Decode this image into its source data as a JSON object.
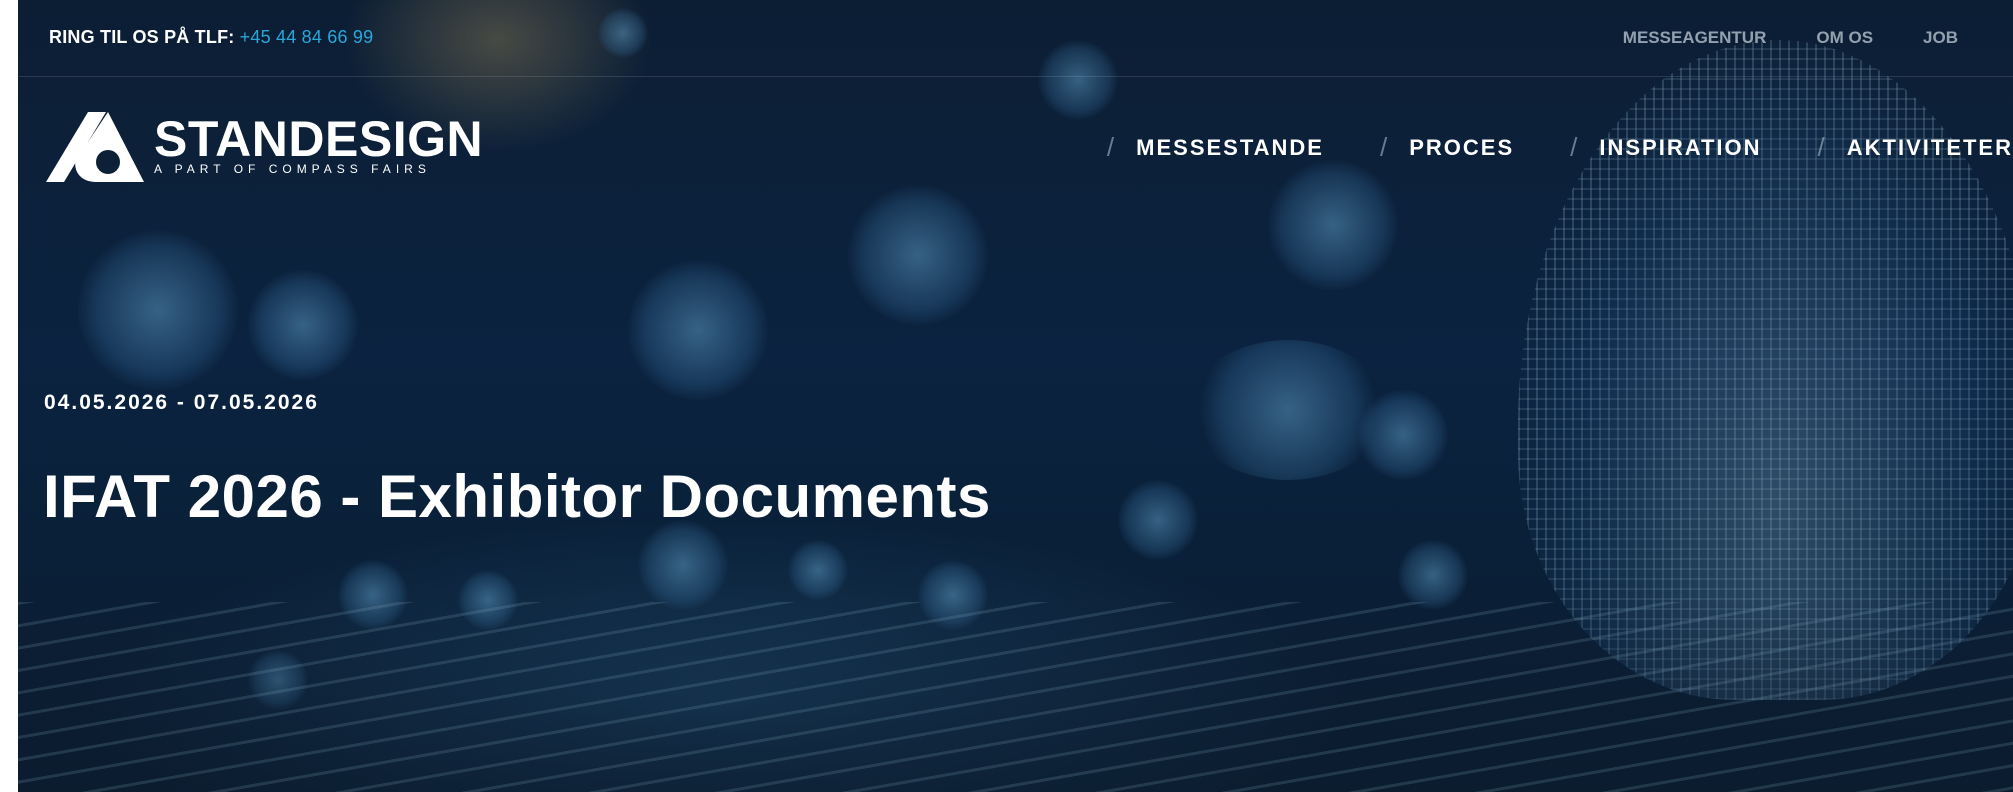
{
  "topbar": {
    "phone_label": "RING TIL OS PÅ TLF:",
    "phone_number": "+45 44 84 66 99",
    "links": [
      "MESSEAGENTUR",
      "OM OS",
      "JOB"
    ]
  },
  "logo": {
    "name": "STANDESIGN",
    "tagline": "A PART OF COMPASS FAIRS",
    "icon": "standesign-logo-icon"
  },
  "nav": {
    "items": [
      "MESSESTANDE",
      "PROCES",
      "INSPIRATION",
      "AKTIVITETER"
    ],
    "separator": "/"
  },
  "hero": {
    "date_range": "04.05.2026 - 07.05.2026",
    "title": "IFAT 2026 - Exhibitor Documents"
  },
  "colors": {
    "accent": "#2aa7d8",
    "background": "#0b2340",
    "text": "#ffffff"
  }
}
